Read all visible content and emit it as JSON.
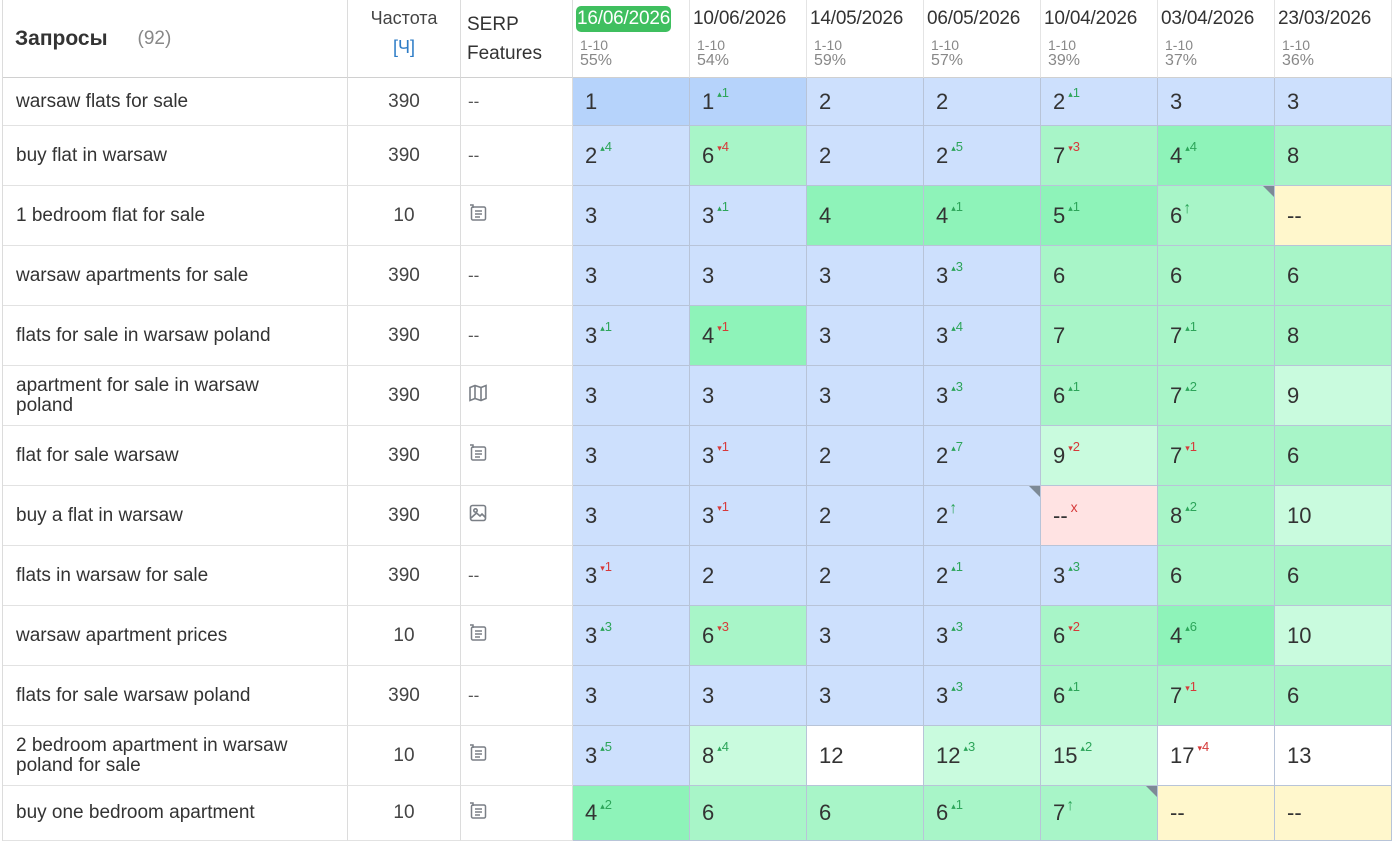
{
  "header": {
    "title": "Запросы",
    "count": "(92)",
    "freq_label": "Частота",
    "freq_mode": "[Ч]",
    "serp_label": "SERP Features"
  },
  "dates": [
    {
      "date": "16/06/2026",
      "range": "1-10",
      "pct": "55%",
      "active": true
    },
    {
      "date": "10/06/2026",
      "range": "1-10",
      "pct": "54%"
    },
    {
      "date": "14/05/2026",
      "range": "1-10",
      "pct": "59%"
    },
    {
      "date": "06/05/2026",
      "range": "1-10",
      "pct": "57%"
    },
    {
      "date": "10/04/2026",
      "range": "1-10",
      "pct": "39%"
    },
    {
      "date": "03/04/2026",
      "range": "1-10",
      "pct": "37%"
    },
    {
      "date": "23/03/2026",
      "range": "1-10",
      "pct": "36%"
    }
  ],
  "colors": {
    "active_date": "#3fbf5f",
    "top": "#b6d3fb",
    "blue": "#cde0fd",
    "green": "#8ef3b9",
    "mid": "#a8f5c8",
    "light": "#c9fbde",
    "yellow": "#fff7cc",
    "red": "#ffe3e3",
    "delta_up": "#2da55a",
    "delta_down": "#d63a3a"
  },
  "rows": [
    {
      "keyword": "warsaw flats for sale",
      "freq": "390",
      "serp": "--",
      "cells": [
        {
          "v": "1",
          "c": "top"
        },
        {
          "v": "1",
          "d": "1",
          "t": "up",
          "c": "top"
        },
        {
          "v": "2",
          "c": "blue"
        },
        {
          "v": "2",
          "c": "blue"
        },
        {
          "v": "2",
          "d": "1",
          "t": "up",
          "c": "blue"
        },
        {
          "v": "3",
          "c": "blue"
        },
        {
          "v": "3",
          "c": "blue"
        }
      ]
    },
    {
      "keyword": "buy flat in warsaw",
      "freq": "390",
      "serp": "--",
      "cells": [
        {
          "v": "2",
          "d": "4",
          "t": "up",
          "c": "blue"
        },
        {
          "v": "6",
          "d": "4",
          "t": "down",
          "c": "mid"
        },
        {
          "v": "2",
          "c": "blue"
        },
        {
          "v": "2",
          "d": "5",
          "t": "up",
          "c": "blue"
        },
        {
          "v": "7",
          "d": "3",
          "t": "down",
          "c": "mid"
        },
        {
          "v": "4",
          "d": "4",
          "t": "up",
          "c": "green"
        },
        {
          "v": "8",
          "c": "mid"
        }
      ]
    },
    {
      "keyword": "1 bedroom flat for sale",
      "freq": "10",
      "serp_icon": "snippet-icon",
      "cells": [
        {
          "v": "3",
          "c": "blue"
        },
        {
          "v": "3",
          "d": "1",
          "t": "up",
          "c": "blue"
        },
        {
          "v": "4",
          "c": "green"
        },
        {
          "v": "4",
          "d": "1",
          "t": "up",
          "c": "green"
        },
        {
          "v": "5",
          "d": "1",
          "t": "up",
          "c": "green"
        },
        {
          "v": "6",
          "d": "↑",
          "t": "arrow",
          "c": "mid",
          "corner": true
        },
        {
          "v": "--",
          "c": "yellow"
        }
      ]
    },
    {
      "keyword": "warsaw apartments for sale",
      "freq": "390",
      "serp": "--",
      "cells": [
        {
          "v": "3",
          "c": "blue"
        },
        {
          "v": "3",
          "c": "blue"
        },
        {
          "v": "3",
          "c": "blue"
        },
        {
          "v": "3",
          "d": "3",
          "t": "up",
          "c": "blue"
        },
        {
          "v": "6",
          "c": "mid"
        },
        {
          "v": "6",
          "c": "mid"
        },
        {
          "v": "6",
          "c": "mid"
        }
      ]
    },
    {
      "keyword": "flats for sale in warsaw poland",
      "freq": "390",
      "serp": "--",
      "cells": [
        {
          "v": "3",
          "d": "1",
          "t": "up",
          "c": "blue"
        },
        {
          "v": "4",
          "d": "1",
          "t": "down",
          "c": "green"
        },
        {
          "v": "3",
          "c": "blue"
        },
        {
          "v": "3",
          "d": "4",
          "t": "up",
          "c": "blue"
        },
        {
          "v": "7",
          "c": "mid"
        },
        {
          "v": "7",
          "d": "1",
          "t": "up",
          "c": "mid"
        },
        {
          "v": "8",
          "c": "mid"
        }
      ]
    },
    {
      "keyword": "apartment for sale in warsaw poland",
      "freq": "390",
      "serp_icon": "map-icon",
      "cells": [
        {
          "v": "3",
          "c": "blue"
        },
        {
          "v": "3",
          "c": "blue"
        },
        {
          "v": "3",
          "c": "blue"
        },
        {
          "v": "3",
          "d": "3",
          "t": "up",
          "c": "blue"
        },
        {
          "v": "6",
          "d": "1",
          "t": "up",
          "c": "mid"
        },
        {
          "v": "7",
          "d": "2",
          "t": "up",
          "c": "mid"
        },
        {
          "v": "9",
          "c": "light"
        }
      ]
    },
    {
      "keyword": "flat for sale warsaw",
      "freq": "390",
      "serp_icon": "snippet-icon",
      "cells": [
        {
          "v": "3",
          "c": "blue"
        },
        {
          "v": "3",
          "d": "1",
          "t": "down",
          "c": "blue"
        },
        {
          "v": "2",
          "c": "blue"
        },
        {
          "v": "2",
          "d": "7",
          "t": "up",
          "c": "blue"
        },
        {
          "v": "9",
          "d": "2",
          "t": "down",
          "c": "light"
        },
        {
          "v": "7",
          "d": "1",
          "t": "down",
          "c": "mid"
        },
        {
          "v": "6",
          "c": "mid"
        }
      ]
    },
    {
      "keyword": "buy a flat in warsaw",
      "freq": "390",
      "serp_icon": "image-icon",
      "cells": [
        {
          "v": "3",
          "c": "blue"
        },
        {
          "v": "3",
          "d": "1",
          "t": "down",
          "c": "blue"
        },
        {
          "v": "2",
          "c": "blue"
        },
        {
          "v": "2",
          "d": "↑",
          "t": "arrow",
          "c": "blue",
          "corner": true
        },
        {
          "v": "--",
          "d": "x",
          "t": "x",
          "c": "red"
        },
        {
          "v": "8",
          "d": "2",
          "t": "up",
          "c": "mid"
        },
        {
          "v": "10",
          "c": "light"
        }
      ]
    },
    {
      "keyword": "flats in warsaw for sale",
      "freq": "390",
      "serp": "--",
      "cells": [
        {
          "v": "3",
          "d": "1",
          "t": "down",
          "c": "blue"
        },
        {
          "v": "2",
          "c": "blue"
        },
        {
          "v": "2",
          "c": "blue"
        },
        {
          "v": "2",
          "d": "1",
          "t": "up",
          "c": "blue"
        },
        {
          "v": "3",
          "d": "3",
          "t": "up",
          "c": "blue"
        },
        {
          "v": "6",
          "c": "mid"
        },
        {
          "v": "6",
          "c": "mid"
        }
      ]
    },
    {
      "keyword": "warsaw apartment prices",
      "freq": "10",
      "serp_icon": "snippet-icon",
      "cells": [
        {
          "v": "3",
          "d": "3",
          "t": "up",
          "c": "blue"
        },
        {
          "v": "6",
          "d": "3",
          "t": "down",
          "c": "mid"
        },
        {
          "v": "3",
          "c": "blue"
        },
        {
          "v": "3",
          "d": "3",
          "t": "up",
          "c": "blue"
        },
        {
          "v": "6",
          "d": "2",
          "t": "down",
          "c": "mid"
        },
        {
          "v": "4",
          "d": "6",
          "t": "up",
          "c": "green"
        },
        {
          "v": "10",
          "c": "light"
        }
      ]
    },
    {
      "keyword": "flats for sale warsaw poland",
      "freq": "390",
      "serp": "--",
      "cells": [
        {
          "v": "3",
          "c": "blue"
        },
        {
          "v": "3",
          "c": "blue"
        },
        {
          "v": "3",
          "c": "blue"
        },
        {
          "v": "3",
          "d": "3",
          "t": "up",
          "c": "blue"
        },
        {
          "v": "6",
          "d": "1",
          "t": "up",
          "c": "mid"
        },
        {
          "v": "7",
          "d": "1",
          "t": "down",
          "c": "mid"
        },
        {
          "v": "6",
          "c": "mid"
        }
      ]
    },
    {
      "keyword": "2 bedroom apartment in warsaw poland for sale",
      "freq": "10",
      "serp_icon": "snippet-icon",
      "cells": [
        {
          "v": "3",
          "d": "5",
          "t": "up",
          "c": "blue"
        },
        {
          "v": "8",
          "d": "4",
          "t": "up",
          "c": "light"
        },
        {
          "v": "12",
          "c": "white"
        },
        {
          "v": "12",
          "d": "3",
          "t": "up",
          "c": "light"
        },
        {
          "v": "15",
          "d": "2",
          "t": "up",
          "c": "light"
        },
        {
          "v": "17",
          "d": "4",
          "t": "down",
          "c": "white"
        },
        {
          "v": "13",
          "c": "white"
        }
      ]
    },
    {
      "keyword": "buy one bedroom apartment",
      "freq": "10",
      "serp_icon": "snippet-icon",
      "cells": [
        {
          "v": "4",
          "d": "2",
          "t": "up",
          "c": "green"
        },
        {
          "v": "6",
          "c": "mid"
        },
        {
          "v": "6",
          "c": "mid"
        },
        {
          "v": "6",
          "d": "1",
          "t": "up",
          "c": "mid"
        },
        {
          "v": "7",
          "d": "↑",
          "t": "arrow",
          "c": "mid",
          "corner": true
        },
        {
          "v": "--",
          "c": "yellow"
        },
        {
          "v": "--",
          "c": "yellow"
        }
      ]
    }
  ]
}
